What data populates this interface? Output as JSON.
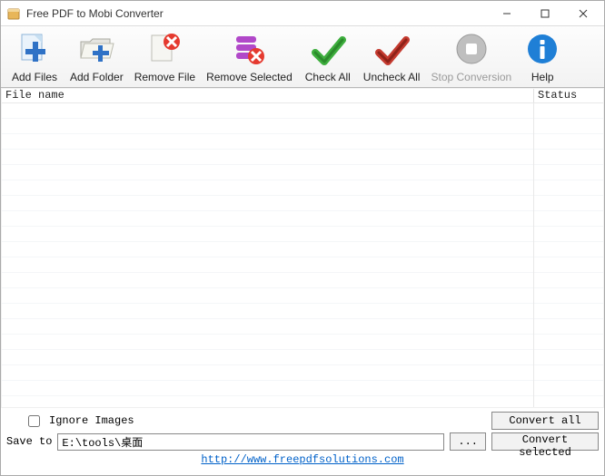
{
  "window": {
    "title": "Free PDF to Mobi Converter"
  },
  "toolbar": {
    "add_files": "Add Files",
    "add_folder": "Add Folder",
    "remove_file": "Remove File",
    "remove_selected": "Remove Selected",
    "check_all": "Check All",
    "uncheck_all": "Uncheck All",
    "stop_conversion": "Stop Conversion",
    "help": "Help"
  },
  "table": {
    "col_file": "File name",
    "col_status": "Status"
  },
  "bottom": {
    "ignore_images": "Ignore Images",
    "save_to": "Save to",
    "path_value": "E:\\tools\\桌面",
    "browse": "...",
    "convert_all": "Convert all",
    "convert_selected": "Convert selected",
    "url": "http://www.freepdfsolutions.com"
  }
}
